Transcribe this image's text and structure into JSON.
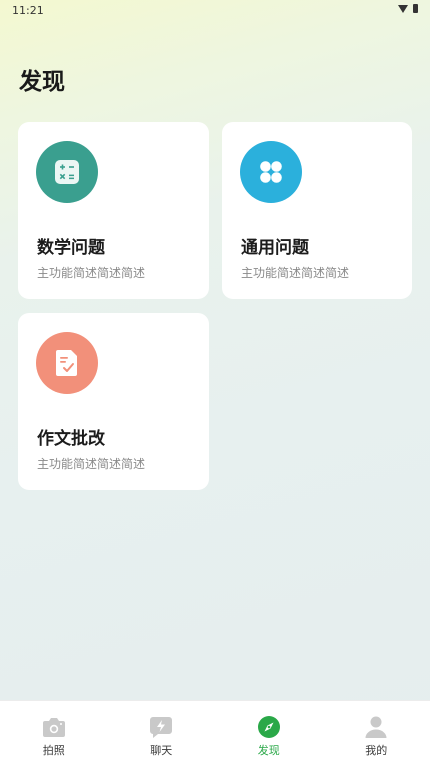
{
  "status": {
    "time": "11:21"
  },
  "page": {
    "title": "发现"
  },
  "cards": [
    {
      "title": "数学问题",
      "desc": "主功能简述简述简述",
      "icon": "calculator-icon",
      "color": "#3a9f8f"
    },
    {
      "title": "通用问题",
      "desc": "主功能简述简述简述",
      "icon": "grid-icon",
      "color": "#2bb0dc"
    },
    {
      "title": "作文批改",
      "desc": "主功能简述简述简述",
      "icon": "document-check-icon",
      "color": "#f2907a"
    }
  ],
  "nav": {
    "items": [
      {
        "label": "拍照",
        "icon": "camera-icon"
      },
      {
        "label": "聊天",
        "icon": "chat-lightning-icon"
      },
      {
        "label": "发现",
        "icon": "compass-icon",
        "active": true
      },
      {
        "label": "我的",
        "icon": "person-icon"
      }
    ],
    "active_color": "#2aa848"
  }
}
